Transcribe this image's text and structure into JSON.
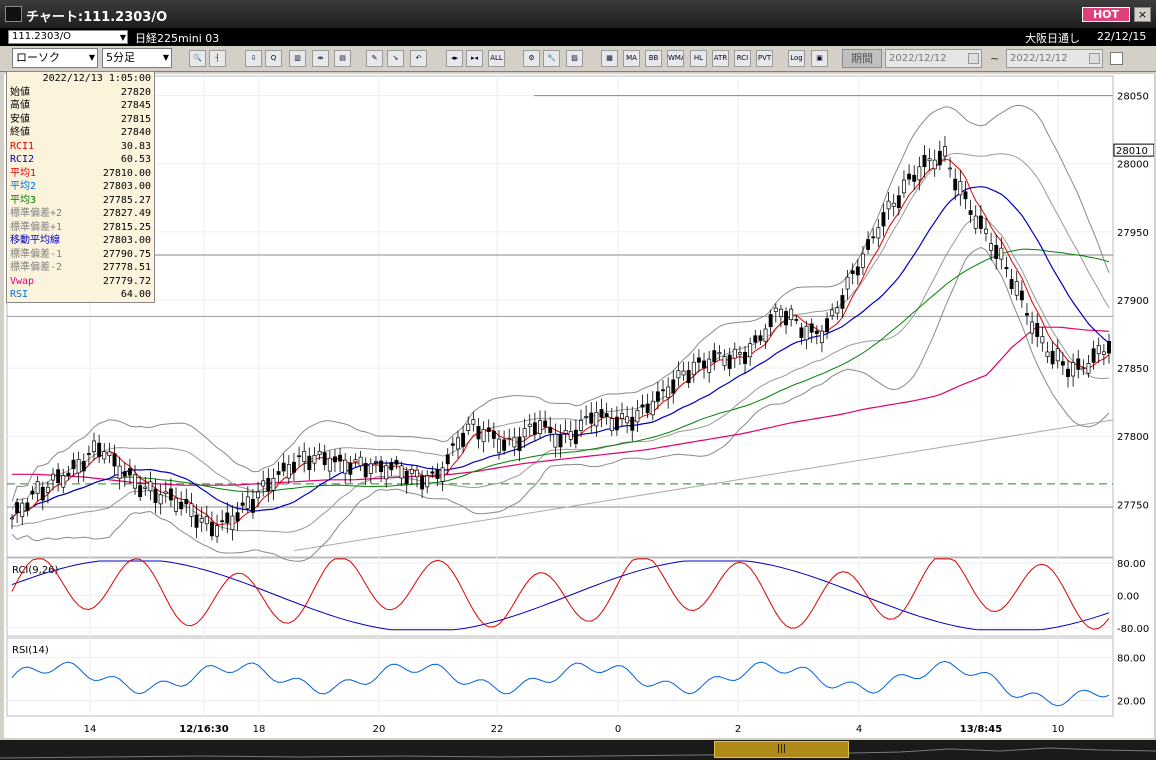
{
  "window": {
    "title": "チャート:111.2303/O",
    "hot_label": "HOT",
    "close_label": "×"
  },
  "infobar": {
    "symbol": "111.2303/O",
    "market_name": "日経225mini 03",
    "exchange": "大阪日通し",
    "date": "22/12/15"
  },
  "toolbar": {
    "chart_type": "ローソク",
    "interval": "5分足",
    "buttons": [
      {
        "name": "zoom-icon",
        "label": "🔍"
      },
      {
        "name": "ruler-icon",
        "label": "┤"
      },
      {
        "name": "download-icon",
        "label": "⇩"
      },
      {
        "name": "magnify-chart-icon",
        "label": "Q"
      },
      {
        "name": "bar-chart-icon",
        "label": "▥"
      },
      {
        "name": "split-icon",
        "label": "⇹"
      },
      {
        "name": "indicator-icon",
        "label": "▤"
      },
      {
        "name": "pencil-icon",
        "label": "✎"
      },
      {
        "name": "cursor-icon",
        "label": "➘"
      },
      {
        "name": "undo-icon",
        "label": "↶"
      },
      {
        "name": "expand-icon",
        "label": "◂▸"
      },
      {
        "name": "shrink-icon",
        "label": "▸◂"
      },
      {
        "name": "all-icon",
        "label": "ALL"
      },
      {
        "name": "settings-icon",
        "label": "⚙"
      },
      {
        "name": "tools-icon",
        "label": "🔧"
      },
      {
        "name": "color-icon",
        "label": "▨"
      },
      {
        "name": "table-icon",
        "label": "▦"
      },
      {
        "name": "ma-icon",
        "label": "MA"
      },
      {
        "name": "bb-icon",
        "label": "BB"
      },
      {
        "name": "wma-icon",
        "label": "WMA"
      },
      {
        "name": "hl-icon",
        "label": "HL"
      },
      {
        "name": "atr-icon",
        "label": "ATR"
      },
      {
        "name": "rci-icon",
        "label": "RCI"
      },
      {
        "name": "pvt-icon",
        "label": "PVT"
      },
      {
        "name": "log-icon",
        "label": "Log"
      },
      {
        "name": "save-icon",
        "label": "▣"
      }
    ],
    "period_label": "期間",
    "date_from": "2022/12/12",
    "date_to": "2022/12/12",
    "tilde": "~"
  },
  "databox": {
    "datetime": "2022/12/13 1:05:00",
    "rows": [
      {
        "label": "始値",
        "value": "27820",
        "color": "#000000"
      },
      {
        "label": "高値",
        "value": "27845",
        "color": "#000000"
      },
      {
        "label": "安値",
        "value": "27815",
        "color": "#000000"
      },
      {
        "label": "終値",
        "value": "27840",
        "color": "#000000"
      },
      {
        "label": "RCI1",
        "value": "30.83",
        "color": "#e00000"
      },
      {
        "label": "RCI2",
        "value": "60.53",
        "color": "#0000c0"
      },
      {
        "label": "平均1",
        "value": "27810.00",
        "color": "#e00000"
      },
      {
        "label": "平均2",
        "value": "27803.00",
        "color": "#0070e0"
      },
      {
        "label": "平均3",
        "value": "27785.27",
        "color": "#008000"
      },
      {
        "label": "標準偏差+2",
        "value": "27827.49",
        "color": "#808080"
      },
      {
        "label": "標準偏差+1",
        "value": "27815.25",
        "color": "#808080"
      },
      {
        "label": "移動平均線",
        "value": "27803.00",
        "color": "#0000c0"
      },
      {
        "label": "標準偏差-1",
        "value": "27790.75",
        "color": "#808080"
      },
      {
        "label": "標準偏差-2",
        "value": "27778.51",
        "color": "#808080"
      },
      {
        "label": "Vwap",
        "value": "27779.72",
        "color": "#e00090"
      },
      {
        "label": "RSI",
        "value": "64.00",
        "color": "#0070e0"
      }
    ]
  },
  "chart_data": {
    "type": "candlestick",
    "price_axis": {
      "ticks": [
        "28050",
        "28000",
        "27950",
        "27900",
        "27850",
        "27800",
        "27750"
      ],
      "ylim": [
        27715,
        28060
      ],
      "current_price_label": "28010"
    },
    "rci_panel": {
      "label": "RCI(9,26)",
      "ticks": [
        "80.00",
        "0.00",
        "-80.00"
      ],
      "ylim": [
        -100,
        100
      ]
    },
    "rsi_panel": {
      "label": "RSI(14)",
      "ticks": [
        "80.00",
        "20.00"
      ],
      "ylim": [
        0,
        100
      ]
    },
    "time_axis": [
      "14",
      "12/16:30",
      "18",
      "20",
      "22",
      "0",
      "2",
      "4",
      "13/8:45",
      "10"
    ],
    "price_path": [
      27740,
      27745,
      27755,
      27760,
      27770,
      27775,
      27780,
      27785,
      27790,
      27780,
      27775,
      27770,
      27765,
      27760,
      27755,
      27750,
      27745,
      27740,
      27735,
      27738,
      27740,
      27745,
      27750,
      27760,
      27770,
      27778,
      27785,
      27785,
      27782,
      27780,
      27778,
      27780,
      27782,
      27780,
      27778,
      27775,
      27770,
      27768,
      27770,
      27775,
      27790,
      27800,
      27805,
      27800,
      27798,
      27795,
      27800,
      27805,
      27810,
      27800,
      27795,
      27800,
      27810,
      27820,
      27815,
      27810,
      27808,
      27812,
      27822,
      27830,
      27840,
      27845,
      27848,
      27850,
      27855,
      27858,
      27860,
      27865,
      27870,
      27880,
      27890,
      27885,
      27880,
      27878,
      27880,
      27890,
      27905,
      27920,
      27935,
      27955,
      27970,
      27980,
      27990,
      27995,
      28000,
      28005,
      27990,
      27975,
      27960,
      27945,
      27930,
      27915,
      27900,
      27885,
      27870,
      27860,
      27850,
      27845,
      27850,
      27860,
      27870
    ],
    "vwap_path": [
      27772,
      27772,
      27771,
      27770,
      27768,
      27766,
      27765,
      27764,
      27764,
      27764,
      27765,
      27766,
      27767,
      27768,
      27768,
      27769,
      27770,
      27771,
      27772,
      27774,
      27777,
      27780,
      27782,
      27784,
      27786,
      27788,
      27790,
      27793,
      27796,
      27799,
      27802,
      27806,
      27810,
      27813,
      27816,
      27820,
      27823,
      27826,
      27830,
      27838,
      27845,
      27865,
      27880,
      27880,
      27878,
      27877
    ]
  }
}
